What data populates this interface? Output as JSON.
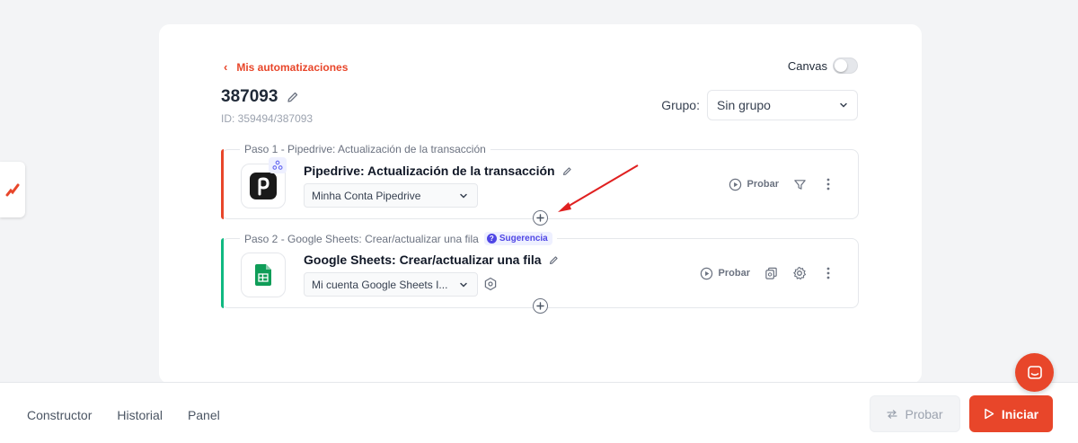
{
  "header": {
    "back_label": "Mis automatizaciones",
    "canvas_label": "Canvas",
    "canvas_enabled": false,
    "title": "387093",
    "id_label": "ID: 359494/387093",
    "group_label": "Grupo:",
    "group_value": "Sin grupo"
  },
  "steps": [
    {
      "legend": "Paso 1 - Pipedrive: Actualización de la transacción",
      "title": "Pipedrive: Actualización de la transacción",
      "account": "Minha Conta Pipedrive",
      "probar_label": "Probar",
      "accent_color": "#e8462a"
    },
    {
      "legend": "Paso 2 - Google Sheets: Crear/actualizar una fila",
      "badge": "Sugerencia",
      "title": "Google Sheets: Crear/actualizar una fila",
      "account": "Mi cuenta Google Sheets I...",
      "probar_label": "Probar",
      "accent_color": "#10b981"
    }
  ],
  "footer": {
    "tabs": [
      "Constructor",
      "Historial",
      "Panel"
    ],
    "probar_label": "Probar",
    "iniciar_label": "Iniciar"
  },
  "colors": {
    "brand": "#e8462a",
    "annotation_arrow": "#e02020"
  }
}
